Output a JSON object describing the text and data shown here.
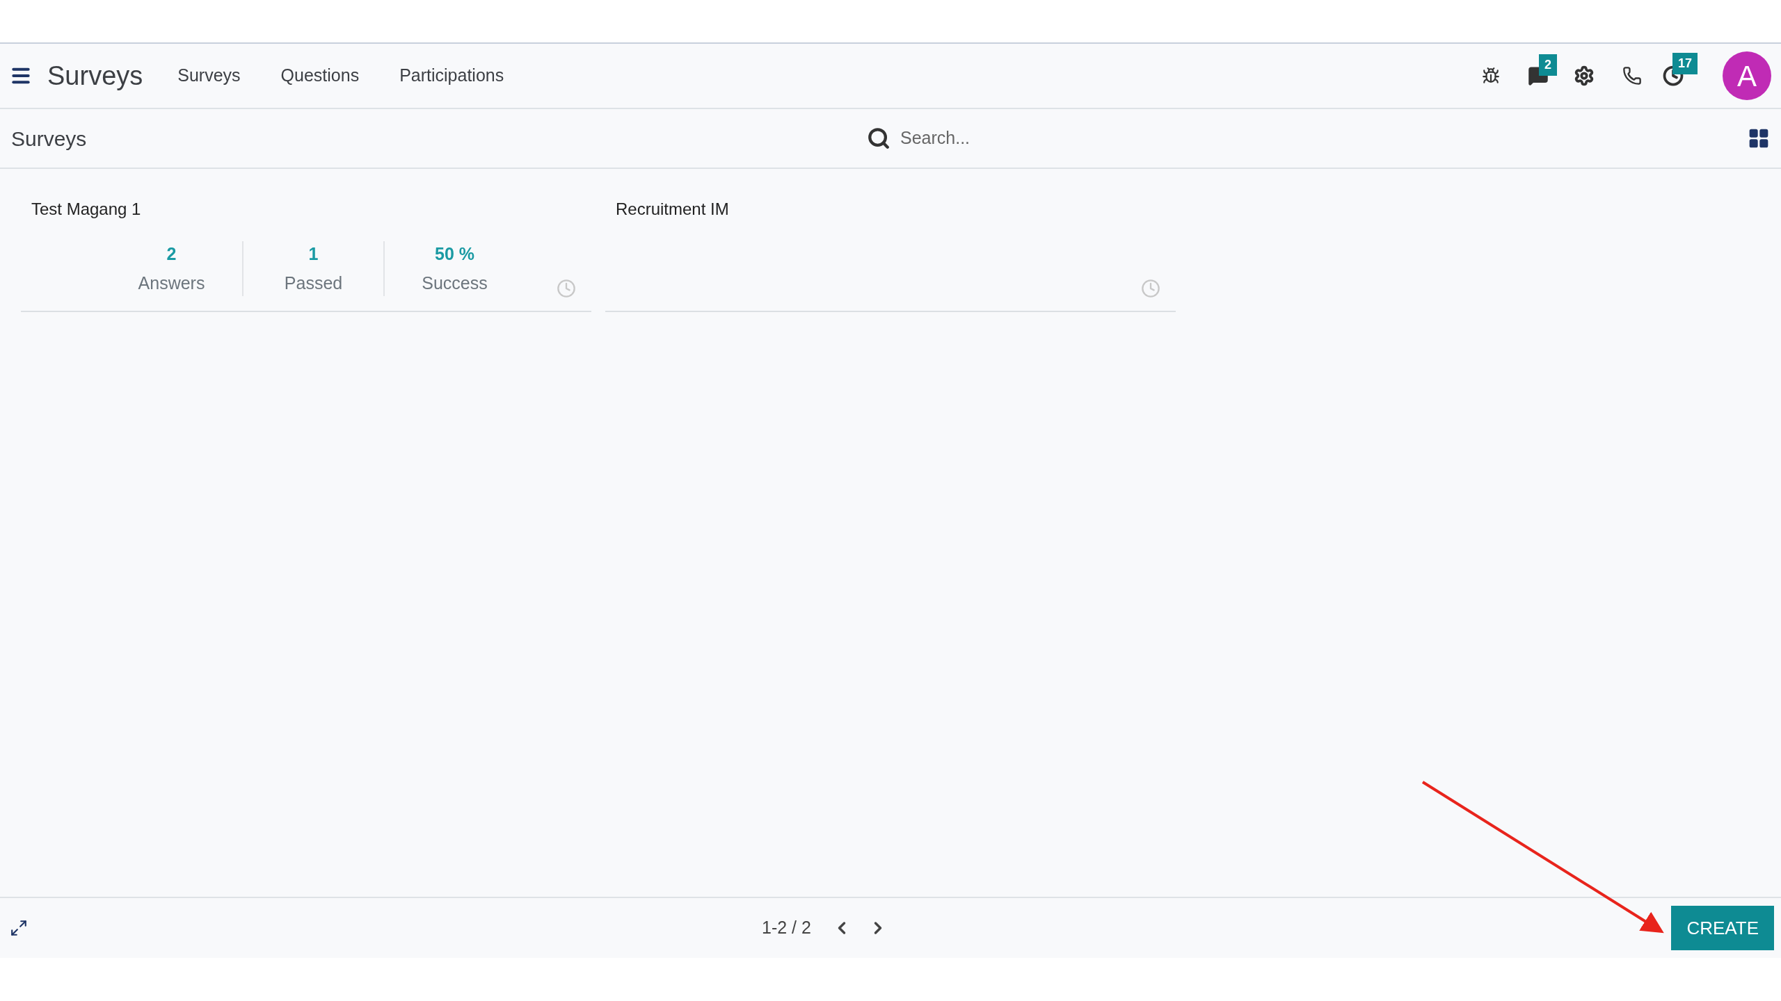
{
  "navbar": {
    "app_title": "Surveys",
    "menu": [
      {
        "label": "Surveys"
      },
      {
        "label": "Questions"
      },
      {
        "label": "Participations"
      }
    ],
    "badges": {
      "messages": "2",
      "activities": "17"
    },
    "avatar": "A"
  },
  "control_panel": {
    "breadcrumb": "Surveys",
    "search": {
      "placeholder": "Search..."
    }
  },
  "cards": [
    {
      "title": "Test Magang 1",
      "stats": [
        {
          "value": "2",
          "label": "Answers"
        },
        {
          "value": "1",
          "label": "Passed"
        },
        {
          "value": "50 %",
          "label": "Success"
        }
      ]
    },
    {
      "title": "Recruitment IM"
    }
  ],
  "footer": {
    "pager": "1-2 / 2",
    "create_button": "CREATE"
  }
}
